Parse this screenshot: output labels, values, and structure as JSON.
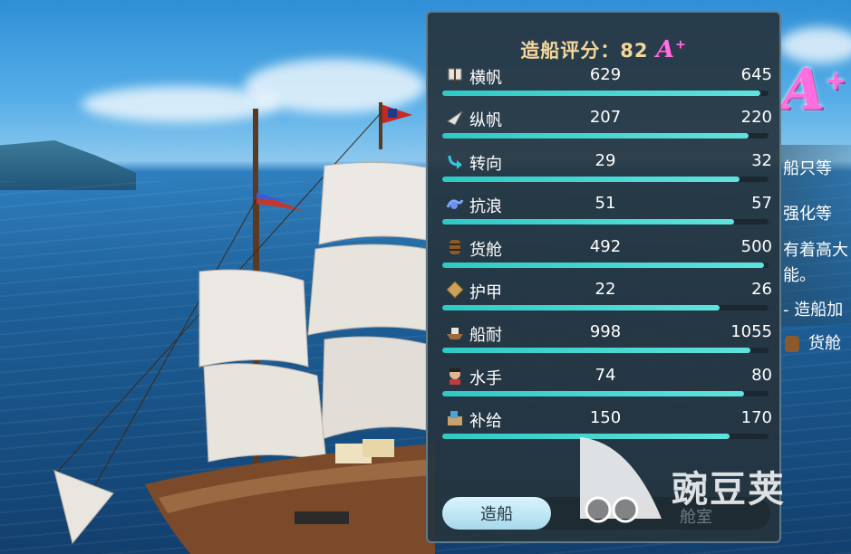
{
  "panel": {
    "title_label": "造船评分：82",
    "grade": "A",
    "grade_sup": "+"
  },
  "stats": [
    {
      "name": "横帆",
      "current": "629",
      "max": "645",
      "fill": 0.975,
      "icon": "square-sail-icon"
    },
    {
      "name": "纵帆",
      "current": "207",
      "max": "220",
      "fill": 0.94,
      "icon": "fore-aft-sail-icon"
    },
    {
      "name": "转向",
      "current": "29",
      "max": "32",
      "fill": 0.91,
      "icon": "turn-arrow-icon"
    },
    {
      "name": "抗浪",
      "current": "51",
      "max": "57",
      "fill": 0.895,
      "icon": "wave-icon"
    },
    {
      "name": "货舱",
      "current": "492",
      "max": "500",
      "fill": 0.985,
      "icon": "barrel-icon"
    },
    {
      "name": "护甲",
      "current": "22",
      "max": "26",
      "fill": 0.85,
      "icon": "armor-plate-icon"
    },
    {
      "name": "船耐",
      "current": "998",
      "max": "1055",
      "fill": 0.945,
      "icon": "ship-hull-icon"
    },
    {
      "name": "水手",
      "current": "74",
      "max": "80",
      "fill": 0.925,
      "icon": "sailor-icon"
    },
    {
      "name": "补给",
      "current": "150",
      "max": "170",
      "fill": 0.88,
      "icon": "supply-icon"
    }
  ],
  "tabs": {
    "active": "造船",
    "inactive": "舱室"
  },
  "side": {
    "grade": "A",
    "grade_sup": "+",
    "line1": "船只等",
    "line2": "强化等",
    "line3": "有着高大",
    "line4": "能。",
    "line5": "- 造船加",
    "line6": "货舱"
  },
  "watermark": {
    "text": "豌豆荚"
  },
  "colors": {
    "panel_bg": "#26343e",
    "bar_fill": "#2fc9c4",
    "title_text": "#f5d79a",
    "grade_pink": "#ff72e2"
  }
}
